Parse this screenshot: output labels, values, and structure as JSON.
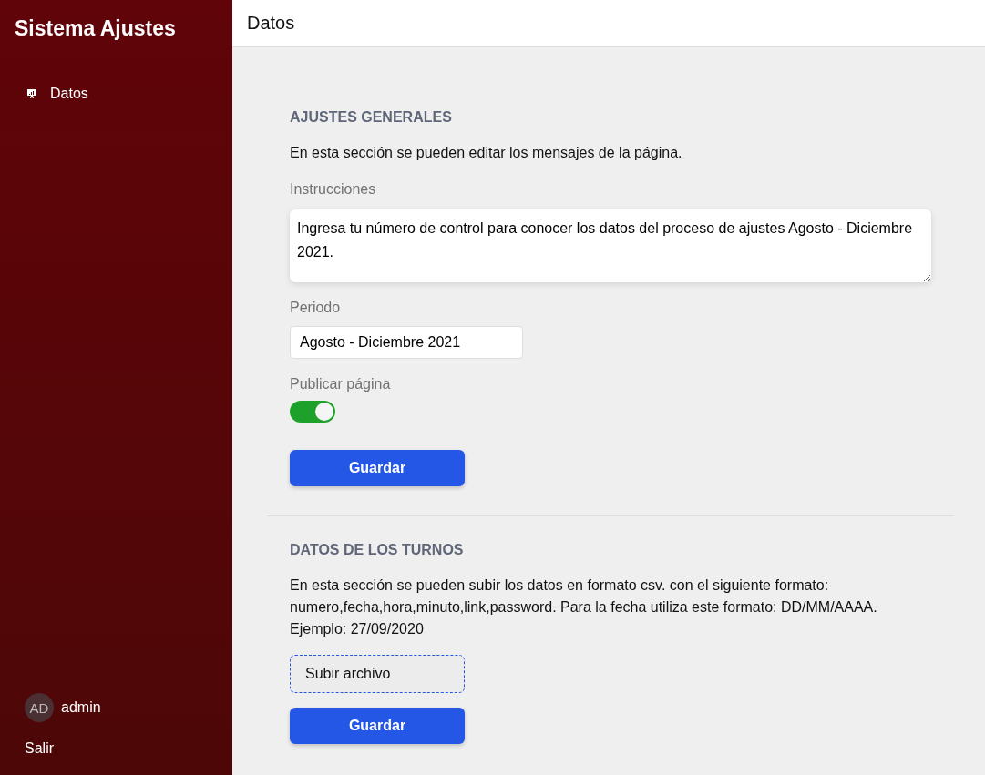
{
  "sidebar": {
    "title": "Sistema Ajustes",
    "items": [
      {
        "label": "Datos"
      }
    ],
    "user": {
      "initials": "AD",
      "name": "admin"
    },
    "logout": "Salir"
  },
  "header": {
    "title": "Datos"
  },
  "general": {
    "heading": "AJUSTES GENERALES",
    "description": "En esta sección se pueden editar los mensajes de la página.",
    "instructions_label": "Instrucciones",
    "instructions": "Ingresa tu número de control para conocer los datos del proceso de ajustes Agosto - Diciembre 2021.",
    "period_label": "Periodo",
    "period": "Agosto - Diciembre 2021",
    "publish_label": "Publicar página",
    "publish_on": true,
    "save": "Guardar"
  },
  "shifts": {
    "heading": "DATOS DE LOS TURNOS",
    "description": "En esta sección se pueden subir los datos en formato csv. con el siguiente formato: numero,fecha,hora,minuto,link,password. Para la fecha utiliza este formato: DD/MM/AAAA. Ejemplo: 27/09/2020",
    "upload": "Subir archivo",
    "save": "Guardar"
  }
}
